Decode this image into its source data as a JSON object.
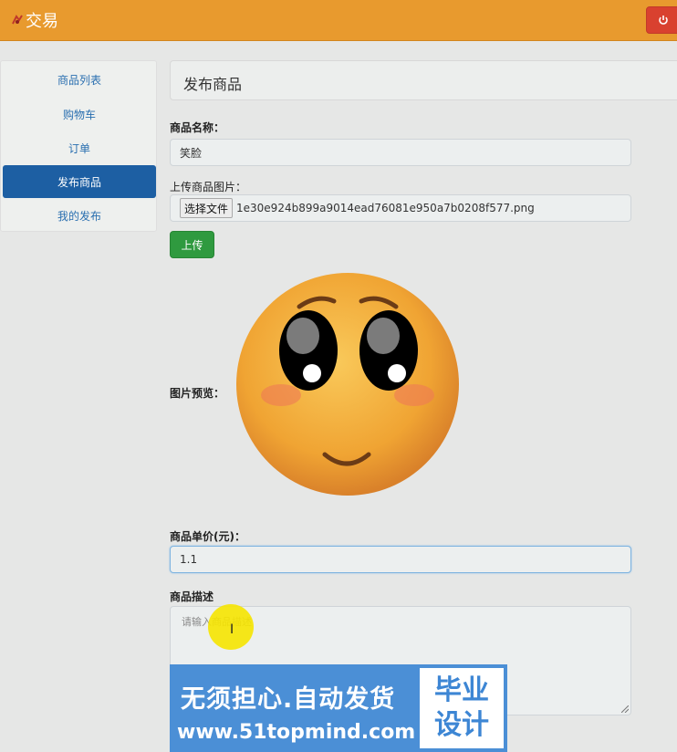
{
  "header": {
    "brand_text": "交易",
    "logout_icon": "power-icon",
    "colors": {
      "bar": "#e89a2e",
      "logout": "#d9412f"
    }
  },
  "sidebar": {
    "items": [
      {
        "label": "商品列表",
        "active": false
      },
      {
        "label": "购物车",
        "active": false
      },
      {
        "label": "订单",
        "active": false
      },
      {
        "label": "发布商品",
        "active": true
      },
      {
        "label": "我的发布",
        "active": false
      }
    ],
    "active_color": "#1d5fa3"
  },
  "form": {
    "title": "发布商品",
    "name_label": "商品名称：",
    "name_value": "笑脸",
    "image_label": "上传商品图片：",
    "choose_file_label": "选择文件",
    "file_name": "1e30e924b899a9014ead76081e950a7b0208f577.png",
    "upload_button": "上传",
    "preview_label": "图片预览：",
    "price_label": "商品单价(元)：",
    "price_value": "1.1",
    "desc_label": "商品描述",
    "desc_placeholder": "请输入商品描述"
  },
  "watermark": {
    "line1": "无须担心.自动发货",
    "line2": "www.51topmind.com",
    "badge_top": "毕业",
    "badge_bottom": "设计"
  }
}
